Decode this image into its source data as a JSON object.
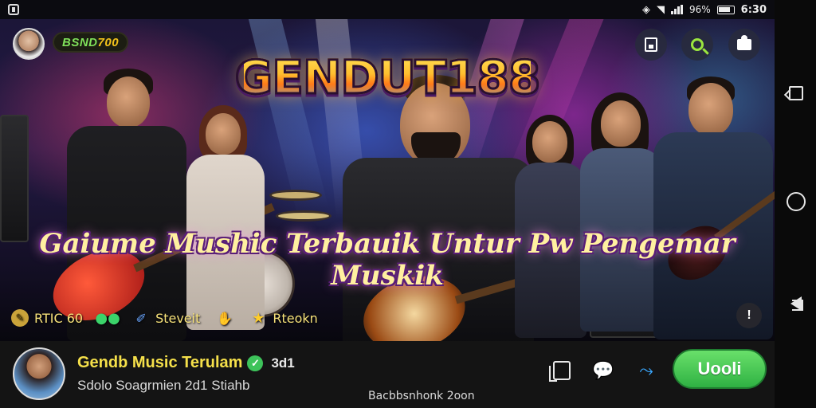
{
  "status_bar": {
    "battery_percent": "96%",
    "time": "6:30"
  },
  "hero": {
    "coin_balance_prefix": "BSND ",
    "coin_balance_value": "700",
    "logo_text": "GENDUT188",
    "headline": "Gaiume Mushic Terbauik Untur Pw Pengemar Muskik",
    "stats": [
      {
        "icon": "coin-icon",
        "label": "RTIC 60"
      },
      {
        "icon": "group-icon",
        "label": ""
      },
      {
        "icon": "pen-icon",
        "label": "Steveit"
      },
      {
        "icon": "hand-icon",
        "label": ""
      },
      {
        "icon": "star-icon",
        "label": "Rteokn"
      }
    ],
    "top_buttons": [
      "save-icon",
      "search-icon",
      "puzzle-icon"
    ],
    "info_label": "!"
  },
  "channel": {
    "name": "Gendb Music Terulam",
    "count": "3d1",
    "subtitle": "Sdolo Soagrmien 2d1 Stiahb"
  },
  "bottom_bar": {
    "center_caption": "Bacbbsnhonk 2oon",
    "like_label": "Uooli",
    "icons": [
      "copy-icon",
      "speech-icon",
      "share-icon"
    ]
  },
  "colors": {
    "accent_green": "#3dc35a",
    "logo_gold": "#ffd23a",
    "headline_text": "#fff0a0",
    "channel_name": "#f5e04a"
  }
}
